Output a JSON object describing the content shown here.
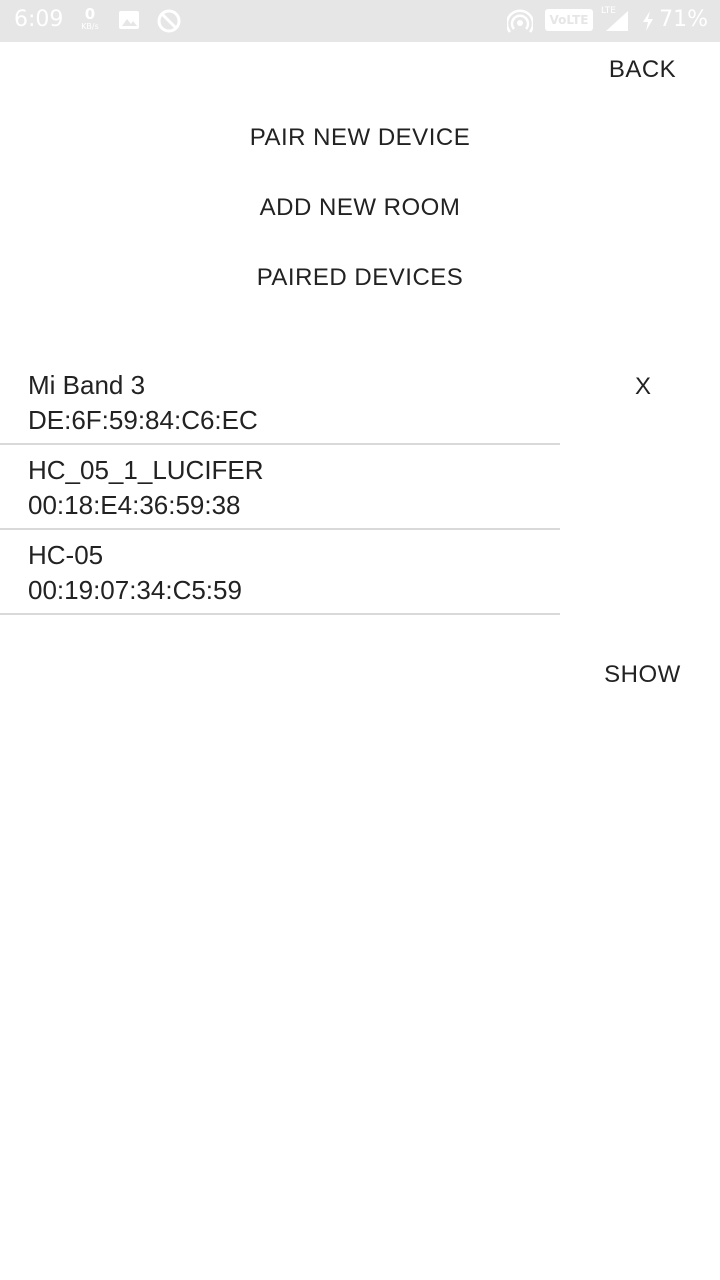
{
  "status_bar": {
    "time": "6:09",
    "net_speed_value": "0",
    "net_speed_unit": "KB/s",
    "icons": [
      "image-icon",
      "no-disturb-icon",
      "hotspot-icon",
      "signal-icon",
      "charging-icon"
    ],
    "volte_label": "VoLTE",
    "lte_label": "LTE",
    "battery": "71%"
  },
  "nav": {
    "back_label": "BACK"
  },
  "menu": {
    "pair_label": "PAIR NEW DEVICE",
    "add_room_label": "ADD NEW ROOM",
    "paired_label": "PAIRED DEVICES"
  },
  "devices": [
    {
      "name": "Mi Band 3",
      "address": "DE:6F:59:84:C6:EC"
    },
    {
      "name": "HC_05_1_LUCIFER",
      "address": "00:18:E4:36:59:38"
    },
    {
      "name": "HC-05",
      "address": "00:19:07:34:C5:59"
    }
  ],
  "actions": {
    "close_label": "X",
    "show_label": "SHOW"
  }
}
